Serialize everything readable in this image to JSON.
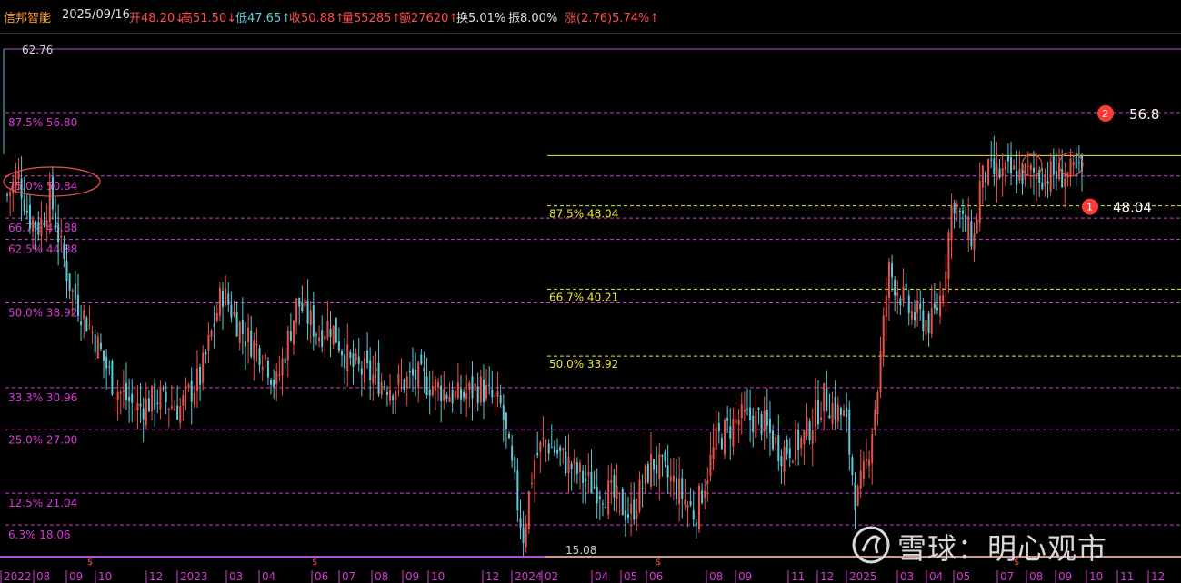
{
  "header": {
    "name": "信邦智能",
    "date": "2025/09/16",
    "open": "开48.20↓",
    "high": "高51.50↓",
    "low": "低47.65↑",
    "close": "收50.88↑",
    "volume": "量55285↑",
    "amount": "额27620↑",
    "turnover": "换5.01%",
    "amplitude": "振8.00%",
    "change": "涨(2.76)5.74%↑"
  },
  "colors": {
    "background": "#000000",
    "up": "#e8534a",
    "down": "#5fc9d8",
    "fib_left": "#d63bd6",
    "fib_right": "#e8e83a",
    "header_orange": "#ff9a2e",
    "header_red": "#ff4d4d",
    "header_cyan": "#5fd0e0",
    "header_white": "#e0e0e0",
    "badge": "#ff3a3a"
  },
  "watermark": {
    "text": "雪球：明心观市",
    "icon": "snowball-logo-icon"
  },
  "chart_data": {
    "type": "candlestick",
    "title": "信邦智能",
    "y_max_label": "62.76",
    "y_min_label": "15.08",
    "ylim": [
      15.08,
      62.76
    ],
    "x_tick_labels": [
      "2022",
      "08",
      "09",
      "10",
      "12",
      "2023",
      "03",
      "04",
      "06",
      "07",
      "08",
      "09",
      "10",
      "12",
      "2024",
      "02",
      "04",
      "05",
      "06",
      "08",
      "09",
      "11",
      "12",
      "2025",
      "03",
      "04",
      "05",
      "07",
      "08",
      "09",
      "10",
      "11",
      "12"
    ],
    "fib_left_levels": [
      {
        "label": "87.5% 56.80",
        "value": 56.8
      },
      {
        "label": "75.0% 50.84",
        "value": 50.84
      },
      {
        "label": "66.7% 46.88",
        "value": 46.88
      },
      {
        "label": "62.5% 44.88",
        "value": 44.88
      },
      {
        "label": "50.0% 38.92",
        "value": 38.92
      },
      {
        "label": "33.3% 30.96",
        "value": 30.96
      },
      {
        "label": "25.0% 27.00",
        "value": 27.0
      },
      {
        "label": "12.5% 21.04",
        "value": 21.04
      },
      {
        "label": "6.3% 18.06",
        "value": 18.06
      }
    ],
    "fib_right_levels": [
      {
        "label": "87.5% 48.04",
        "value": 48.04
      },
      {
        "label": "66.7% 40.21",
        "value": 40.21
      },
      {
        "label": "50.0% 33.92",
        "value": 33.92
      }
    ],
    "fib_right_top": 52.75,
    "fib_right_bottom": 15.08,
    "targets": [
      {
        "badge": "2",
        "value_label": "56.8",
        "value": 56.8
      },
      {
        "badge": "1",
        "value_label": "48.04",
        "value": 48.04
      }
    ],
    "price_path": [
      [
        0,
        49
      ],
      [
        0.01,
        51
      ],
      [
        0.02,
        47
      ],
      [
        0.03,
        46
      ],
      [
        0.04,
        49
      ],
      [
        0.05,
        44
      ],
      [
        0.06,
        40
      ],
      [
        0.08,
        36
      ],
      [
        0.1,
        31
      ],
      [
        0.12,
        29
      ],
      [
        0.14,
        30
      ],
      [
        0.16,
        29
      ],
      [
        0.18,
        32
      ],
      [
        0.2,
        40
      ],
      [
        0.22,
        36
      ],
      [
        0.24,
        34
      ],
      [
        0.25,
        31
      ],
      [
        0.27,
        39
      ],
      [
        0.29,
        36
      ],
      [
        0.3,
        37
      ],
      [
        0.32,
        33
      ],
      [
        0.34,
        32
      ],
      [
        0.36,
        31
      ],
      [
        0.38,
        32
      ],
      [
        0.4,
        31
      ],
      [
        0.42,
        30
      ],
      [
        0.44,
        31
      ],
      [
        0.46,
        29
      ],
      [
        0.47,
        23
      ],
      [
        0.48,
        17
      ],
      [
        0.49,
        24
      ],
      [
        0.5,
        26
      ],
      [
        0.52,
        24
      ],
      [
        0.54,
        22
      ],
      [
        0.56,
        21
      ],
      [
        0.58,
        19
      ],
      [
        0.6,
        24
      ],
      [
        0.62,
        22
      ],
      [
        0.64,
        19
      ],
      [
        0.66,
        26
      ],
      [
        0.68,
        28
      ],
      [
        0.7,
        28
      ],
      [
        0.72,
        25
      ],
      [
        0.74,
        26
      ],
      [
        0.76,
        30
      ],
      [
        0.78,
        28
      ],
      [
        0.79,
        20
      ],
      [
        0.8,
        24
      ],
      [
        0.81,
        31
      ],
      [
        0.82,
        42
      ],
      [
        0.84,
        38
      ],
      [
        0.86,
        37
      ],
      [
        0.87,
        40
      ],
      [
        0.88,
        49
      ],
      [
        0.89,
        46
      ],
      [
        0.9,
        45
      ],
      [
        0.905,
        50
      ],
      [
        0.91,
        51
      ]
    ]
  }
}
